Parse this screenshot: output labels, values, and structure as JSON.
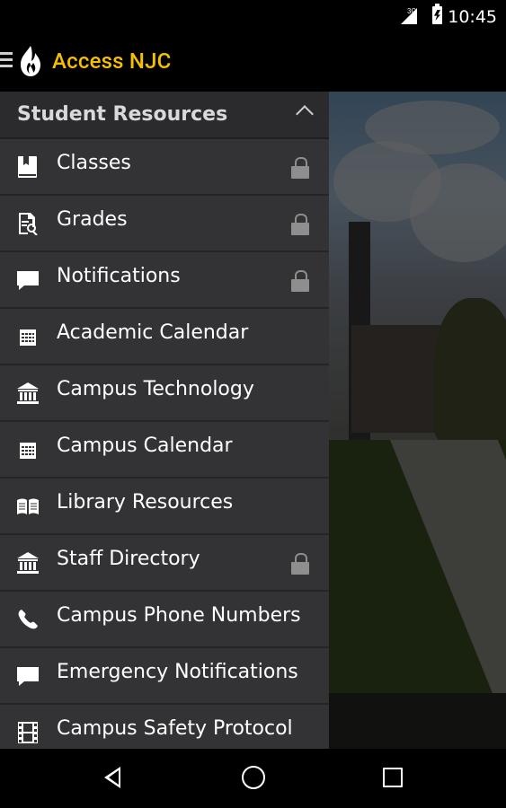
{
  "status_bar": {
    "network": "3G",
    "time": "10:45"
  },
  "app_bar": {
    "title": "Access NJC",
    "title_color": "#f5bf00",
    "logo_icon": "flame-icon"
  },
  "drawer": {
    "section_title": "Student Resources",
    "items": [
      {
        "label": "Classes",
        "icon": "book-icon",
        "locked": true
      },
      {
        "label": "Grades",
        "icon": "report-icon",
        "locked": true
      },
      {
        "label": "Notifications",
        "icon": "chat-bubble-icon",
        "locked": true
      },
      {
        "label": "Academic Calendar",
        "icon": "calendar-icon",
        "locked": false
      },
      {
        "label": "Campus Technology",
        "icon": "building-icon",
        "locked": false
      },
      {
        "label": "Campus Calendar",
        "icon": "calendar-icon",
        "locked": false
      },
      {
        "label": "Library Resources",
        "icon": "open-book-icon",
        "locked": false
      },
      {
        "label": "Staff Directory",
        "icon": "building-icon",
        "locked": true
      },
      {
        "label": "Campus Phone Numbers",
        "icon": "phone-icon",
        "locked": false
      },
      {
        "label": "Emergency Notifications",
        "icon": "chat-bubble-icon",
        "locked": false
      },
      {
        "label": "Campus Safety Protocol",
        "icon": "film-icon",
        "locked": false
      }
    ]
  },
  "colors": {
    "drawer_bg": "#333335",
    "accent": "#f5bf00"
  }
}
